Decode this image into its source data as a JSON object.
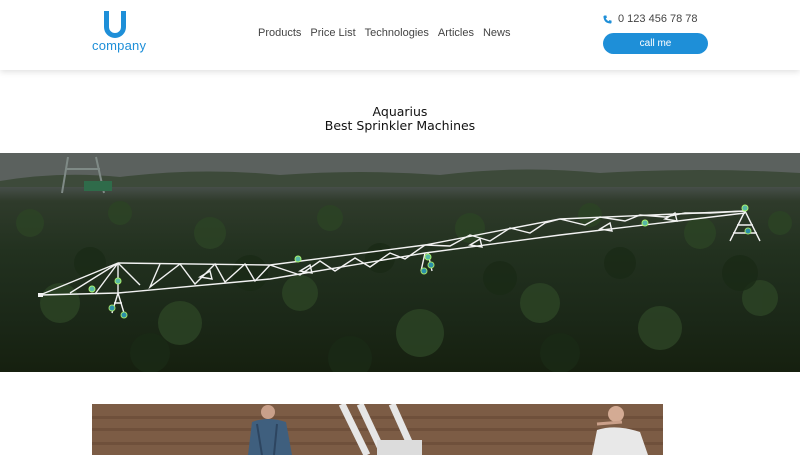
{
  "brand": {
    "logo_text": "company",
    "colors": {
      "accent": "#1e8fd8"
    }
  },
  "nav": {
    "items": [
      {
        "label": "Products"
      },
      {
        "label": "Price List"
      },
      {
        "label": "Technologies"
      },
      {
        "label": "Articles"
      },
      {
        "label": "News"
      }
    ]
  },
  "contact": {
    "phone": "0 123 456 78 78",
    "call_button": "call me",
    "phone_icon": "phone-icon"
  },
  "hero": {
    "line1": "Aquarius",
    "line2": "Best Sprinkler Machines"
  }
}
